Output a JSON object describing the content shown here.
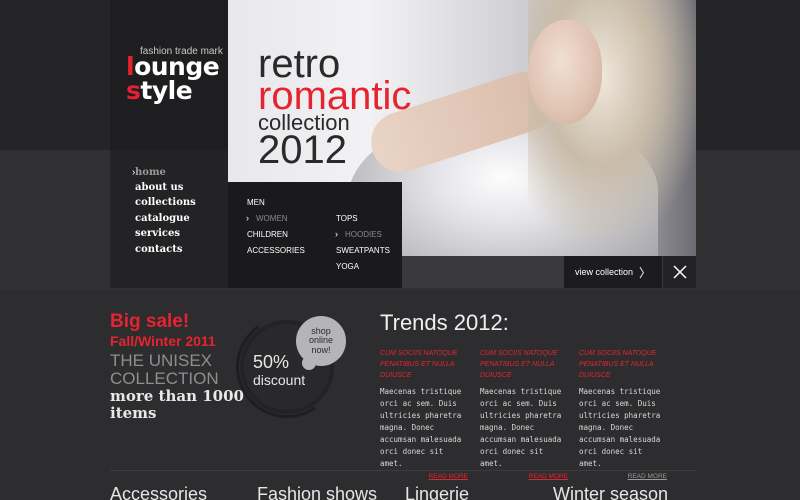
{
  "brand": {
    "tagline": "fashion trade mark",
    "line1_red": "l",
    "line1_rest": "ounge",
    "line2_red": "s",
    "line2_rest": "tyle"
  },
  "nav": {
    "items": [
      "home",
      "about us",
      "collections",
      "catalogue",
      "services",
      "contacts"
    ],
    "active": "home"
  },
  "hero": {
    "line1": "retro",
    "line2": "romantic",
    "line3": "collection",
    "line4": "2012",
    "view_label": "view collection"
  },
  "submenu": {
    "col1": [
      "MEN",
      "WOMEN",
      "CHILDREN",
      "ACCESSORIES"
    ],
    "col2": [
      "TOPS",
      "HOODIES",
      "SWEATPANTS",
      "YOGA"
    ]
  },
  "sale": {
    "big": "Big sale!",
    "season": "Fall/Winter 2011",
    "unisex1": "THE UNISEX",
    "unisex2": "COLLECTION",
    "more1": "more than 1000",
    "more2": "items",
    "percent": "50%",
    "discount": "discount",
    "shop1": "shop",
    "shop2": "online",
    "shop3": "now!"
  },
  "trends": {
    "title": "Trends 2012:",
    "items": [
      {
        "heading": "CUM SOCIIS NATOQUE PENATIBUS ET NULLA DUIUSCE",
        "body": "Maecenas tristique orci ac sem. Duis ultricies pharetra magna. Donec accumsan malesuada orci donec sit amet.",
        "more": "READ MORE"
      },
      {
        "heading": "CUM SOCIIS NATOQUE PENATIBUS ET NULLA DUIUSCE",
        "body": "Maecenas tristique orci ac sem. Duis ultricies pharetra magna. Donec accumsan malesuada orci donec sit amet.",
        "more": "READ MORE"
      },
      {
        "heading": "CUM SOCIIS NATOQUE PENATIBUS ET NULLA DUIUSCE",
        "body": "Maecenas tristique orci ac sem. Duis ultricies pharetra magna. Donec accumsan malesuada orci donec sit amet.",
        "more": "READ MORE"
      }
    ]
  },
  "categories": [
    "Accessories",
    "Fashion shows",
    "Lingerie",
    "Winter season"
  ],
  "colors": {
    "accent": "#e52430",
    "background": "#2b2b2d"
  },
  "icons": {
    "view_arrow": "chevron-right-icon",
    "close": "close-icon"
  }
}
